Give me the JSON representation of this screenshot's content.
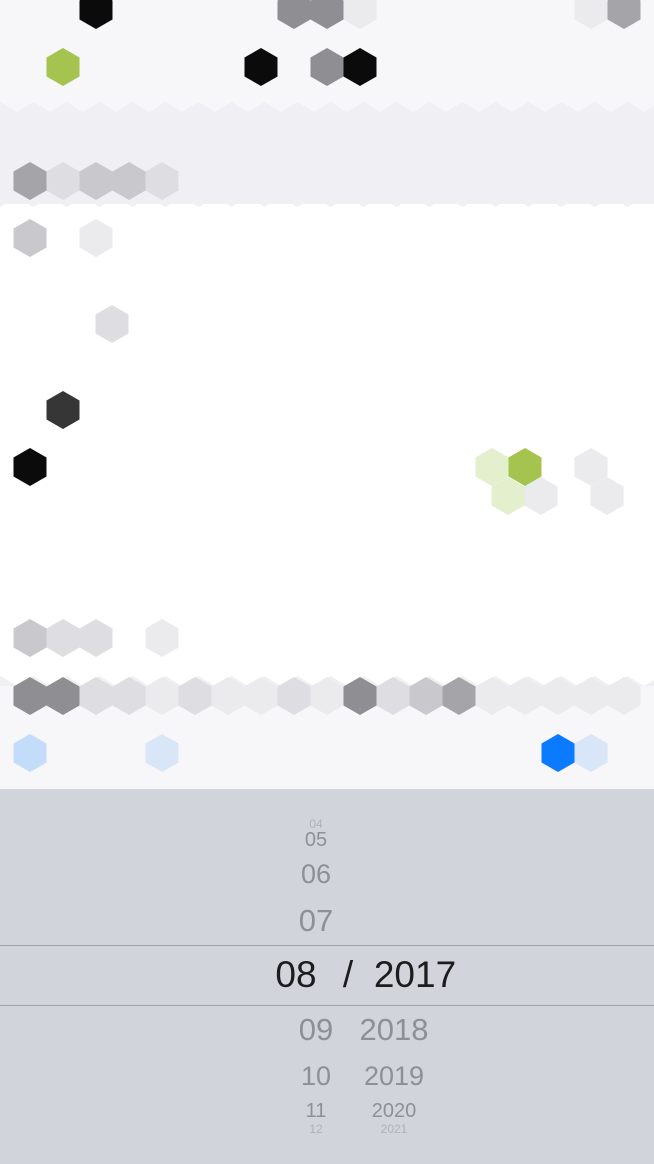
{
  "contribution_grid": {
    "palette": {
      "black": "#0b0b0b",
      "dark": "#363636",
      "gray": "#8e8e93",
      "mid": "#a4a4a9",
      "light": "#c8c8cd",
      "faint": "#dedee2",
      "faint2": "#ebebee",
      "green": "#a5c34f",
      "green_light": "#e3efcd",
      "blue": "#0a7aff",
      "blue_light": "#c3dcf9",
      "blue_faint": "#d9e6f7"
    }
  },
  "date_picker": {
    "months_above": [
      "04",
      "05",
      "06",
      "07"
    ],
    "selected_month": "08",
    "separator": "/",
    "selected_year": "2017",
    "months_below": [
      "09",
      "10",
      "11",
      "12"
    ],
    "years_below": [
      "2018",
      "2019",
      "2020",
      "2021"
    ],
    "selection_band_color": "#9fa3ab"
  }
}
